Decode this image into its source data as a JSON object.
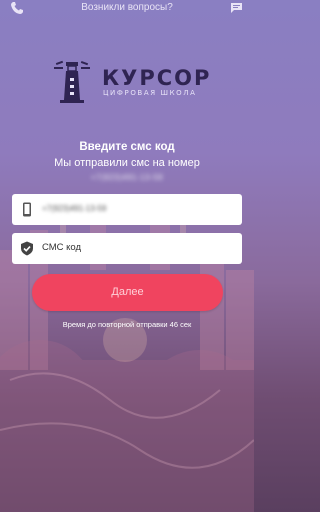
{
  "header": {
    "help_text": "Возникли вопросы?",
    "phone_icon": "phone-icon",
    "chat_icon": "chat-icon"
  },
  "logo": {
    "title": "КУРСОР",
    "subtitle": "ЦИФРОВАЯ ШКОЛА",
    "icon": "lighthouse-icon"
  },
  "sms": {
    "heading": "Введите смс код",
    "subheading": "Мы отправили смс на номер",
    "masked_number": "+7(923)491-13-59"
  },
  "form": {
    "phone_value": "+7(923)491-13-59",
    "code_placeholder": "СМС код",
    "submit_label": "Далее",
    "resend_text": "Время до повторной отправки 46 сек"
  },
  "colors": {
    "accent": "#f0445f",
    "logo_dark": "#2f2452",
    "background_top": "#8a7fc2",
    "background_bottom": "#5a3f5f"
  }
}
